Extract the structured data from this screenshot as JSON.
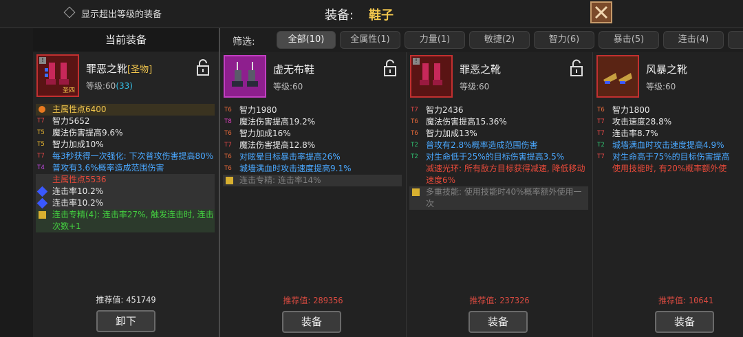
{
  "header": {
    "show_overlevel_label": "显示超出等级的装备",
    "title_label": "装备:",
    "title_value": "鞋子"
  },
  "current": {
    "panel_title": "当前装备",
    "name": "罪恶之靴",
    "tag": "[圣物]",
    "level_prefix": "等级:60",
    "level_bonus": "(33)",
    "icon_badge": "圣四",
    "stats": [
      {
        "tier": "",
        "text": "主属性点6400",
        "cls": "y"
      },
      {
        "tier": "T7",
        "text": "智力5652",
        "cls": "w"
      },
      {
        "tier": "T5",
        "text": "魔法伤害提高9.6%",
        "cls": "w"
      },
      {
        "tier": "T5",
        "text": "智力加成10%",
        "cls": "w"
      },
      {
        "tier": "T7",
        "text": "每3秒获得一次强化: 下次普攻伤害提高80%",
        "cls": "b"
      },
      {
        "tier": "T4",
        "text": "普攻有3.6%概率造成范围伤害",
        "cls": "b"
      },
      {
        "tier": "",
        "text": "主属性点5536",
        "cls": "r"
      },
      {
        "tier": "",
        "text": "连击率10.2%",
        "cls": "w"
      },
      {
        "tier": "",
        "text": "连击率10.2%",
        "cls": "w"
      },
      {
        "tier": "",
        "text": "连击专精(4): 连击率27%, 触发连击时, 连击次数+1",
        "cls": "g"
      }
    ],
    "score_label": "推荐值:",
    "score_value": "451749",
    "button": "卸下"
  },
  "filter": {
    "label": "筛选:",
    "tabs": [
      "全部(10)",
      "全属性(1)",
      "力量(1)",
      "敏捷(2)",
      "智力(6)",
      "暴击(5)",
      "连击(4)"
    ]
  },
  "cards": [
    {
      "name": "虚无布鞋",
      "level": "等级:60",
      "stats": [
        {
          "tier": "T6",
          "text": "智力1980",
          "cls": "w"
        },
        {
          "tier": "T8",
          "text": "魔法伤害提高19.2%",
          "cls": "w"
        },
        {
          "tier": "T6",
          "text": "智力加成16%",
          "cls": "w"
        },
        {
          "tier": "T7",
          "text": "魔法伤害提高12.8%",
          "cls": "w"
        },
        {
          "tier": "T6",
          "text": "对眩晕目标暴击率提高26%",
          "cls": "b"
        },
        {
          "tier": "T6",
          "text": "城墙满血时攻击速度提高9.1%",
          "cls": "b"
        },
        {
          "tier": "",
          "text": "连击专精: 连击率14%",
          "cls": "gy"
        }
      ],
      "score_label": "推荐值:",
      "score_value": "289356",
      "button": "装备"
    },
    {
      "name": "罪恶之靴",
      "level": "等级:60",
      "stats": [
        {
          "tier": "T7",
          "text": "智力2436",
          "cls": "w"
        },
        {
          "tier": "T6",
          "text": "魔法伤害提高15.36%",
          "cls": "w"
        },
        {
          "tier": "T6",
          "text": "智力加成13%",
          "cls": "w"
        },
        {
          "tier": "T2",
          "text": "普攻有2.8%概率造成范围伤害",
          "cls": "b"
        },
        {
          "tier": "T2",
          "text": "对生命低于25%的目标伤害提高3.5%",
          "cls": "b"
        },
        {
          "tier": "",
          "text": "减速光环: 所有敌方目标获得减速, 降低移动速度6%",
          "cls": "r"
        },
        {
          "tier": "",
          "text": "多重技能: 使用技能时40%概率额外使用一次",
          "cls": "gy"
        }
      ],
      "score_label": "推荐值:",
      "score_value": "237326",
      "button": "装备"
    },
    {
      "name": "风暴之靴",
      "level": "等级:60",
      "stats": [
        {
          "tier": "T6",
          "text": "智力1800",
          "cls": "w"
        },
        {
          "tier": "T7",
          "text": "攻击速度28.8%",
          "cls": "w"
        },
        {
          "tier": "T7",
          "text": "连击率8.7%",
          "cls": "w"
        },
        {
          "tier": "T2",
          "text": "城墙满血时攻击速度提高4.9%",
          "cls": "b"
        },
        {
          "tier": "T7",
          "text": "对生命高于75%的目标伤害提高",
          "cls": "b"
        },
        {
          "tier": "",
          "text": "使用技能时, 有20%概率额外使",
          "cls": "r"
        }
      ],
      "score_label": "推荐值:",
      "score_value": "10641",
      "button": "装备"
    }
  ]
}
